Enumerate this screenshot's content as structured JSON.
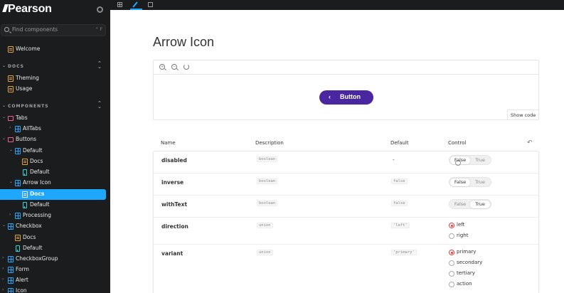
{
  "sidebar": {
    "logo": "Pearson",
    "search": {
      "placeholder": "Find components",
      "shortcut": "⌃ F"
    },
    "welcome": "Welcome",
    "sections": {
      "docs": "DOCS",
      "components": "COMPONENTS"
    },
    "items": {
      "theming": "Theming",
      "usage": "Usage",
      "tabs": "Tabs",
      "alltabs": "AllTabs",
      "buttons": "Buttons",
      "default": "Default",
      "default_docs": "Docs",
      "default_story": "Default",
      "arrow_icon": "Arrow Icon",
      "arrow_docs": "Docs",
      "arrow_default": "Default",
      "processing": "Processing",
      "checkbox": "Checkbox",
      "checkbox_docs": "Docs",
      "checkbox_default": "Default",
      "checkboxgroup": "CheckboxGroup",
      "form": "Form",
      "alert": "Alert",
      "icon": "Icon"
    }
  },
  "toolbar": {
    "icons": [
      "grid-icon",
      "pencil-icon",
      "frame-icon"
    ],
    "active_tab_color": "#1ea7fd"
  },
  "main": {
    "title": "Arrow Icon",
    "preview": {
      "button_label": "Button",
      "button_color": "#4a27a0",
      "show_code": "Show code"
    },
    "table": {
      "headers": {
        "name": "Name",
        "description": "Description",
        "default": "Default",
        "control": "Control"
      },
      "rows": {
        "disabled": {
          "name": "disabled",
          "type": "boolean",
          "default": "-",
          "false": "False",
          "true": "True"
        },
        "inverse": {
          "name": "inverse",
          "type": "boolean",
          "default": "false",
          "false": "False",
          "true": "True"
        },
        "withText": {
          "name": "withText",
          "type": "boolean",
          "default": "false",
          "false": "False",
          "true": "True"
        },
        "direction": {
          "name": "direction",
          "type": "union",
          "default": "'left'",
          "options": [
            "left",
            "right"
          ],
          "selected": "left"
        },
        "variant": {
          "name": "variant",
          "type": "union",
          "default": "'primary'",
          "options": [
            "primary",
            "secondary",
            "tertiary",
            "action"
          ],
          "selected": "primary"
        }
      }
    }
  }
}
